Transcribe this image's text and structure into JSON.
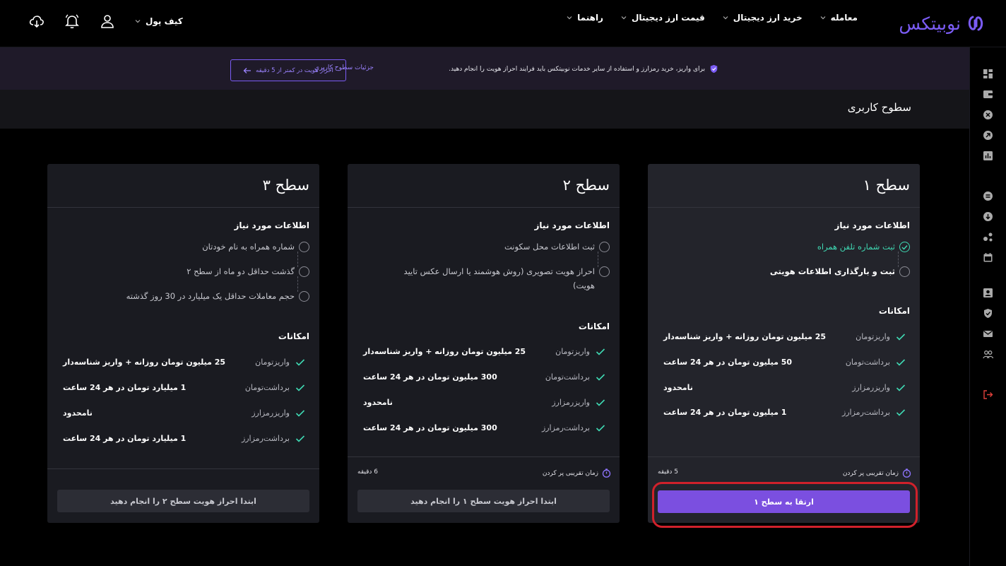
{
  "header": {
    "logo_text": "نوبیتکس",
    "nav": [
      {
        "label": "معامله"
      },
      {
        "label": "خرید ارز دیجیتال"
      },
      {
        "label": "قیمت ارز دیجیتال"
      },
      {
        "label": "راهنما"
      }
    ],
    "wallet_label": "کیف پول",
    "icons": [
      "user-icon",
      "bell-icon",
      "download-cloud-icon"
    ]
  },
  "banner": {
    "message": "برای واریز، خرید رمزارز و استفاده از سایر خدمات نوبیتکس باید فرایند احراز هویت را انجام دهید.",
    "link": "جزئیات سطوح کاربری",
    "button": "احراز هویت در کمتر از 5 دقیقه"
  },
  "page_title": "سطوح کاربری",
  "colors": {
    "accent": "#7b4fe0",
    "success": "#3fd9b3",
    "highlight": "#d0212b"
  },
  "cards": [
    {
      "title": "سطح ۱",
      "req_label": "اطلاعات مورد نیاز",
      "requirements": [
        {
          "text": "ثبت شماره تلفن همراه",
          "done": true
        },
        {
          "text": "ثبت و بارگذاری اطلاعات هویتی",
          "done": false
        }
      ],
      "feat_label": "امکانات",
      "features": [
        {
          "name": "واریزتومان",
          "value": "25 میلیون تومان روزانه + واریز شناسه‌دار"
        },
        {
          "name": "برداشت‌تومان",
          "value": "50 میلیون تومان در هر 24 ساعت"
        },
        {
          "name": "واریزرمزارز",
          "value": "نامحدود"
        },
        {
          "name": "برداشت‌رمزارز",
          "value": "1 میلیون تومان در هر 24 ساعت"
        }
      ],
      "time_label": "زمان تقریبی پر کردن",
      "time_value": "5 دقیقه",
      "button": "ارتقا به سطح ۱"
    },
    {
      "title": "سطح ۲",
      "req_label": "اطلاعات مورد نیاز",
      "requirements": [
        {
          "text": "ثبت اطلاعات محل سکونت",
          "done": false
        },
        {
          "text": "احراز هویت تصویری (روش هوشمند یا ارسال عکس تایید هویت)",
          "done": false
        }
      ],
      "feat_label": "امکانات",
      "features": [
        {
          "name": "واریزتومان",
          "value": "25 میلیون تومان روزانه + واریز شناسه‌دار"
        },
        {
          "name": "برداشت‌تومان",
          "value": "300 میلیون تومان در هر 24 ساعت"
        },
        {
          "name": "واریزرمزارز",
          "value": "نامحدود"
        },
        {
          "name": "برداشت‌رمزارز",
          "value": "300 میلیون تومان در هر 24 ساعت"
        }
      ],
      "time_label": "زمان تقریبی پر کردن",
      "time_value": "6 دقیقه",
      "button": "ابتدا احراز هویت سطح ۱ را انجام دهید"
    },
    {
      "title": "سطح ۳",
      "req_label": "اطلاعات مورد نیاز",
      "requirements": [
        {
          "text": "شماره همراه به نام خودتان",
          "done": false
        },
        {
          "text": "گذشت حداقل دو ماه از سطح ۲",
          "done": false
        },
        {
          "text": "حجم معاملات حداقل یک میلیارد در 30 روز گذشته",
          "done": false
        }
      ],
      "feat_label": "امکانات",
      "features": [
        {
          "name": "واریزتومان",
          "value": "25 میلیون تومان روزانه + واریز شناسه‌دار"
        },
        {
          "name": "برداشت‌تومان",
          "value": "1 میلیارد تومان در هر 24 ساعت"
        },
        {
          "name": "واریزرمزارز",
          "value": "نامحدود"
        },
        {
          "name": "برداشت‌رمزارز",
          "value": "1 میلیارد تومان در هر 24 ساعت"
        }
      ],
      "button": "ابتدا احراز هویت سطح ۲ را انجام دهید"
    }
  ]
}
